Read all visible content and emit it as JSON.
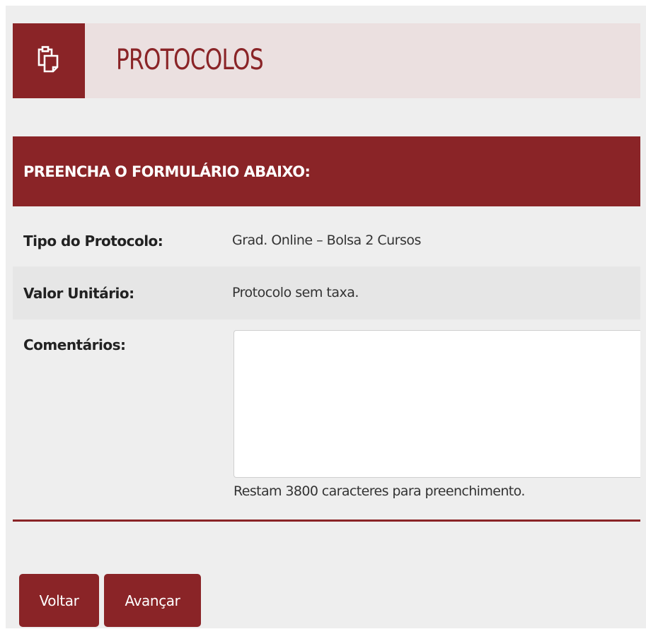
{
  "header": {
    "title": "PROTOCOLOS",
    "icon": "clipboard-icon"
  },
  "form": {
    "section_title": "PREENCHA O FORMULÁRIO ABAIXO:",
    "fields": [
      {
        "label": "Tipo do Protocolo:",
        "value": "Grad. Online – Bolsa 2 Cursos"
      },
      {
        "label": "Valor Unitário:",
        "value": "Protocolo sem taxa."
      }
    ],
    "comments": {
      "label": "Comentários:",
      "value": "",
      "hint": "Restam 3800 caracteres para preenchimento."
    }
  },
  "buttons": {
    "back": "Voltar",
    "next": "Avançar"
  },
  "colors": {
    "primary": "#8a2427",
    "header_bg": "#ebe0e0",
    "panel_bg": "#eeeeee",
    "alt_row_bg": "#e6e6e6"
  }
}
